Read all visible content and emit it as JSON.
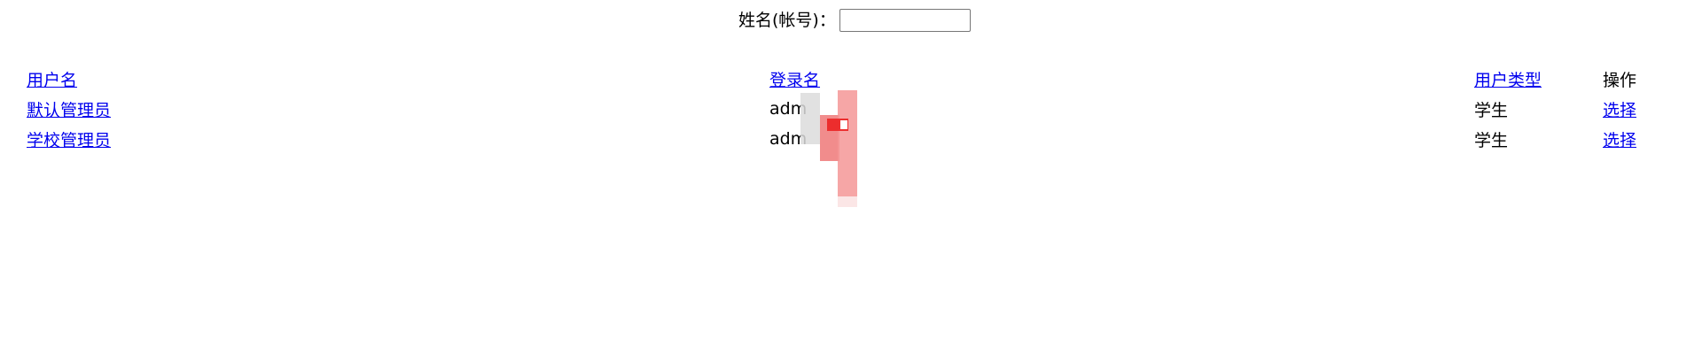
{
  "search": {
    "label": "姓名(帐号)：",
    "value": "",
    "placeholder": ""
  },
  "table": {
    "headers": {
      "name": "用户名",
      "login": "登录名",
      "type": "用户类型",
      "operation": "操作"
    },
    "rows": [
      {
        "name": "默认管理员",
        "login": "adm",
        "type": "学生",
        "action": "选择"
      },
      {
        "name": "学校管理员",
        "login": "adm",
        "type": "学生",
        "action": "选择"
      }
    ]
  },
  "colors": {
    "link": "#0000ee",
    "text": "#000000",
    "background": "#ffffff"
  }
}
